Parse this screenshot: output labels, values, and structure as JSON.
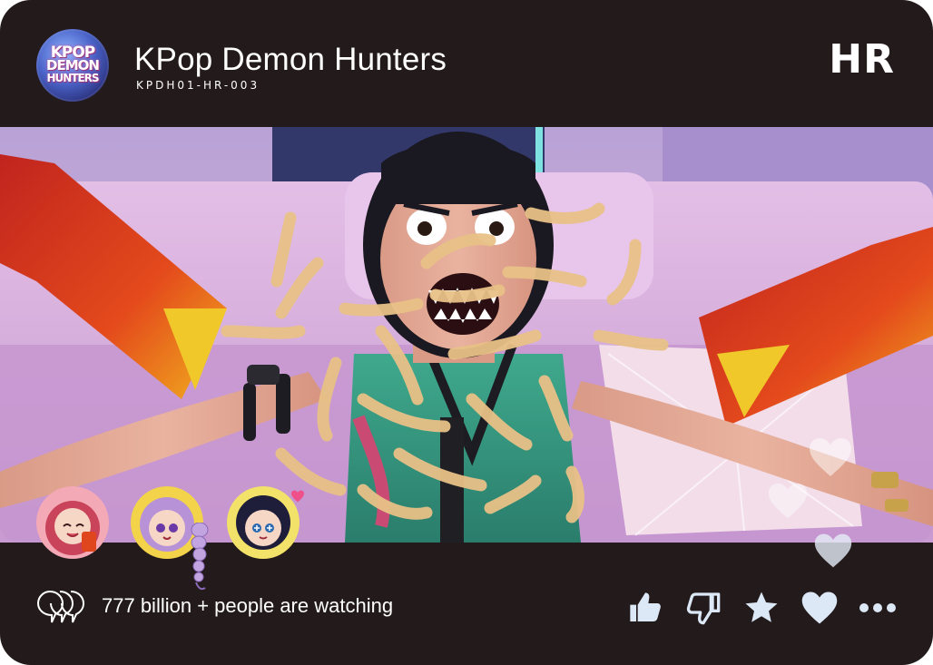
{
  "header": {
    "logo_text": [
      "KPOP",
      "DEMON",
      "HUNTERS"
    ],
    "title": "KPop Demon Hunters",
    "code": "KPDH01-HR-003",
    "badge": "HR"
  },
  "footer": {
    "viewers_text": "777 billion + people are watching",
    "actions": [
      "thumbs-up-icon",
      "thumbs-down-icon",
      "star-icon",
      "heart-icon",
      "more-icon"
    ]
  },
  "colors": {
    "frame": "#231a1b",
    "text": "#ffffff",
    "icon": "#dce8f6"
  }
}
